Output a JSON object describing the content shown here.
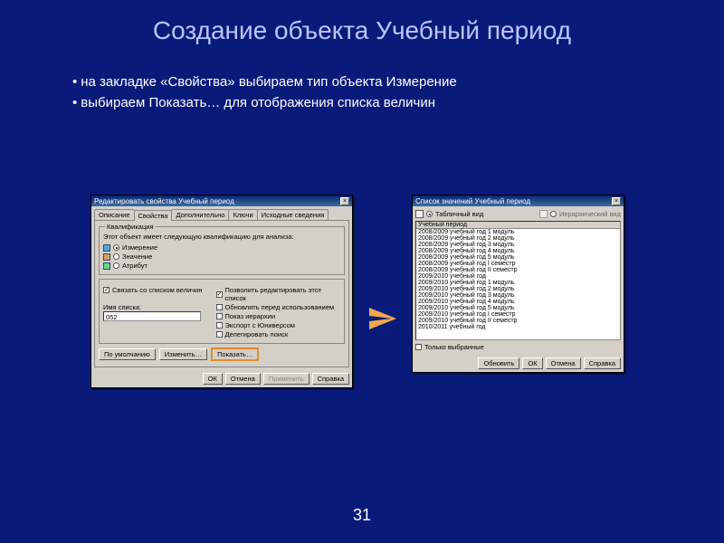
{
  "slide": {
    "title": "Создание объекта Учебный период",
    "bullets": [
      "на закладке «Свойства» выбираем тип объекта Измерение",
      "выбираем Показать… для отображения списка величин"
    ],
    "page_number": "31"
  },
  "win1": {
    "title": "Редактировать свойства Учебный период",
    "tabs": [
      "Описание",
      "Свойства",
      "Дополнительно",
      "Ключи",
      "Исходные сведения"
    ],
    "active_tab": 1,
    "qual_group": "Квалификация",
    "qual_desc": "Этот объект имеет следующую квалификацию для анализа:",
    "radios": [
      {
        "label": "Измерение",
        "selected": true
      },
      {
        "label": "Значение",
        "selected": false
      },
      {
        "label": "Атрибут",
        "selected": false
      }
    ],
    "link_check": {
      "label": "Связать со списком величин",
      "checked": true
    },
    "list_name_label": "Имя списка:",
    "list_name_value": "052",
    "right_checks": [
      {
        "label": "Позволить редактировать этот список",
        "checked": true
      },
      {
        "label": "Обновлять перед использованием",
        "checked": false
      },
      {
        "label": "Показ иерархии",
        "checked": false
      },
      {
        "label": "Экспорт с Юниверсом",
        "checked": false
      },
      {
        "label": "Делегировать поиск",
        "checked": false
      }
    ],
    "btns_mid": [
      "По умолчанию",
      "Изменить…",
      "Показать…"
    ],
    "btns_bot": [
      "ОК",
      "Отмена",
      "Применить",
      "Справка"
    ]
  },
  "win2": {
    "title": "Список значений Учебный период",
    "view_table": "Табличный вид",
    "view_tree": "Иерархический вид",
    "header": "Учебный период",
    "items": [
      "2008/2009 учебный год 1 модуль",
      "2008/2009 учебный год 2 модуль",
      "2008/2009 учебный год 3 модуль",
      "2008/2009 учебный год 4 модуль",
      "2008/2009 учебный год 5 модуль",
      "2008/2009 учебный год I семестр",
      "2008/2009 учебный год II семестр",
      "2009/2010 учебный год",
      "2009/2010 учебный год 1 модуль",
      "2009/2010 учебный год 2 модуль",
      "2009/2010 учебный год 3 модуль",
      "2009/2010 учебный год 4 модуль",
      "2009/2010 учебный год 5 модуль",
      "2009/2010 учебный год I семестр",
      "2009/2010 учебный год II семестр",
      "2010/2011 учебный год"
    ],
    "only_selected": "Только выбранные",
    "btns": [
      "Обновить",
      "ОК",
      "Отмена",
      "Справка"
    ]
  }
}
